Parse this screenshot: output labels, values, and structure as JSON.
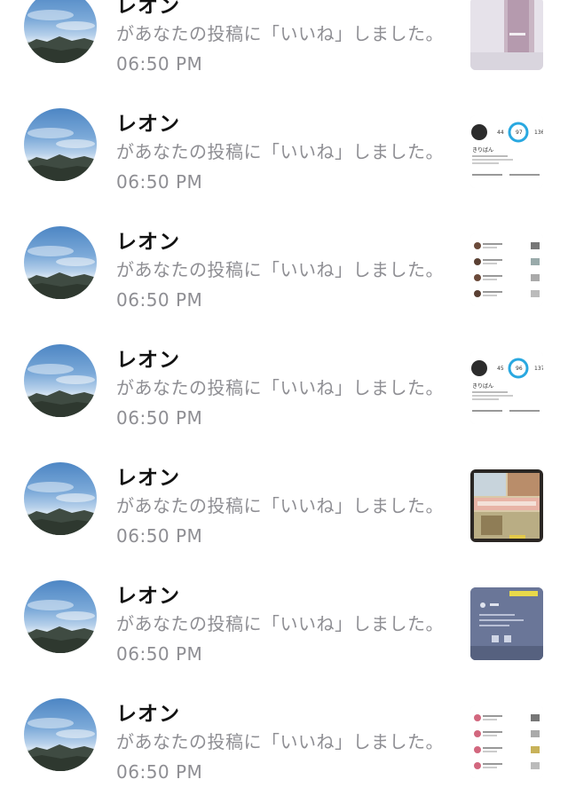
{
  "notifications": [
    {
      "name": "レオン",
      "message": "があなたの投稿に「いいね」しました。",
      "time": "06:50 PM",
      "thumb_type": "photo-bottle"
    },
    {
      "name": "レオン",
      "message": "があなたの投稿に「いいね」しました。",
      "time": "06:50 PM",
      "thumb_type": "profile-screenshot",
      "thumb_numbers": [
        "44",
        "97",
        "136"
      ],
      "thumb_username": "きりばん"
    },
    {
      "name": "レオン",
      "message": "があなたの投稿に「いいね」しました。",
      "time": "06:50 PM",
      "thumb_type": "list-screenshot"
    },
    {
      "name": "レオン",
      "message": "があなたの投稿に「いいね」しました。",
      "time": "06:50 PM",
      "thumb_type": "profile-screenshot",
      "thumb_numbers": [
        "45",
        "96",
        "137"
      ],
      "thumb_username": "きりばん"
    },
    {
      "name": "レオン",
      "message": "があなたの投稿に「いいね」しました。",
      "time": "06:50 PM",
      "thumb_type": "photo-food"
    },
    {
      "name": "レオン",
      "message": "があなたの投稿に「いいね」しました。",
      "time": "06:50 PM",
      "thumb_type": "photo-phone-blue"
    },
    {
      "name": "レオン",
      "message": "があなたの投稿に「いいね」しました。",
      "time": "06:50 PM",
      "thumb_type": "list-screenshot-pink"
    }
  ],
  "colors": {
    "name_text": "#111111",
    "secondary_text": "#8e8e93",
    "highlight_circle": "#29a8e0",
    "background": "#ffffff"
  }
}
